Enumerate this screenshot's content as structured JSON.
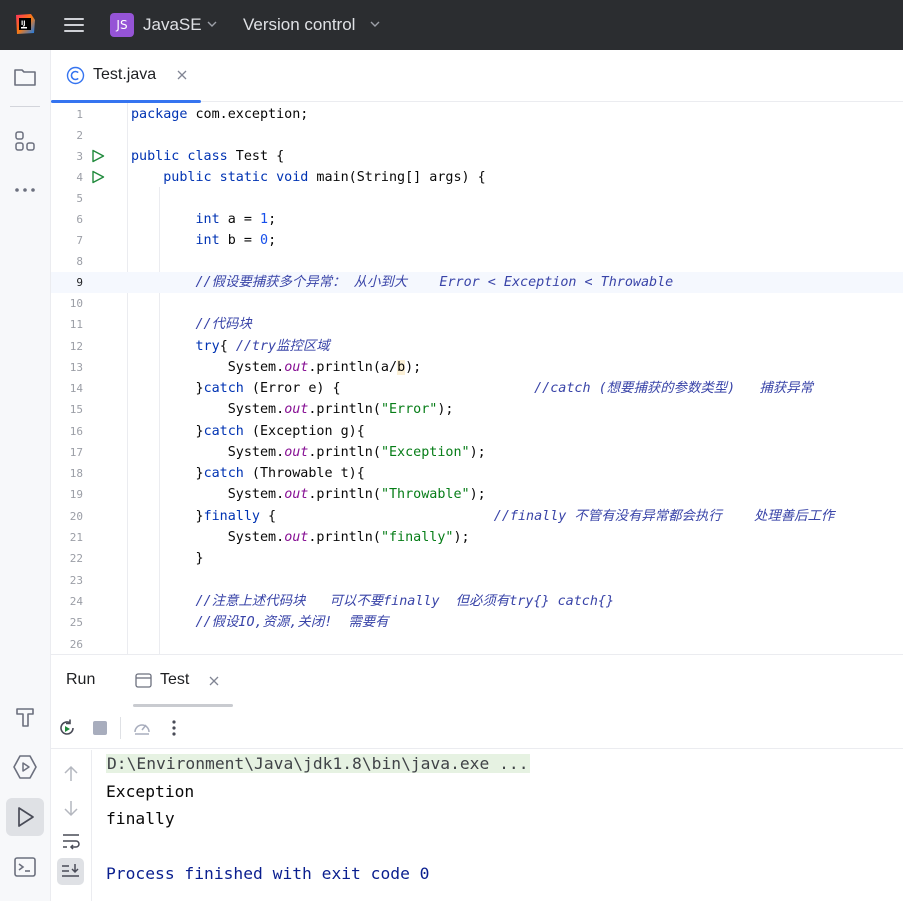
{
  "titlebar": {
    "project_badge": "JS",
    "project_name": "JavaSE",
    "vcs_label": "Version control"
  },
  "editor_tab": {
    "filename": "Test.java"
  },
  "code_lines": [
    {
      "n": "1"
    },
    {
      "n": "2"
    },
    {
      "n": "3"
    },
    {
      "n": "4"
    },
    {
      "n": "5"
    },
    {
      "n": "6"
    },
    {
      "n": "7"
    },
    {
      "n": "8"
    },
    {
      "n": "9"
    },
    {
      "n": "10"
    },
    {
      "n": "11"
    },
    {
      "n": "12"
    },
    {
      "n": "13"
    },
    {
      "n": "14"
    },
    {
      "n": "15"
    },
    {
      "n": "16"
    },
    {
      "n": "17"
    },
    {
      "n": "18"
    },
    {
      "n": "19"
    },
    {
      "n": "20"
    },
    {
      "n": "21"
    },
    {
      "n": "22"
    },
    {
      "n": "23"
    },
    {
      "n": "24"
    },
    {
      "n": "25"
    },
    {
      "n": "26"
    }
  ],
  "code": {
    "l1_kw": "package",
    "l1_rest": " com.exception;",
    "l3_kw": "public class",
    "l3_rest": " Test {",
    "l4_kw": "public static void",
    "l4_rest": " main(String[] args) {",
    "l6_kw": "int",
    "l6_rest": " a = ",
    "l6_num": "1",
    "l6_end": ";",
    "l7_kw": "int",
    "l7_rest": " b = ",
    "l7_num": "0",
    "l7_end": ";",
    "l9_cmt": "//假设要捕获多个异常： 从小到大    Error < Exception < Throwable",
    "l11_cmt": "//代码块",
    "l12_kw": "try",
    "l12_rest": "{ ",
    "l12_cmt": "//try监控区域",
    "l13_a": "System.",
    "l13_fld": "out",
    "l13_b": ".println(a/",
    "l13_mark": "b",
    "l13_c": ");",
    "l14_a": "}",
    "l14_kw": "catch",
    "l14_rest": " (Error e) {",
    "l14_cmt": "//catch (想要捕获的参数类型)   捕获异常",
    "l15_a": "System.",
    "l15_fld": "out",
    "l15_b": ".println(",
    "l15_str": "\"Error\"",
    "l15_c": ");",
    "l16_a": "}",
    "l16_kw": "catch",
    "l16_rest": " (Exception g){",
    "l17_a": "System.",
    "l17_fld": "out",
    "l17_b": ".println(",
    "l17_str": "\"Exception\"",
    "l17_c": ");",
    "l18_a": "}",
    "l18_kw": "catch",
    "l18_rest": " (Throwable t){",
    "l19_a": "System.",
    "l19_fld": "out",
    "l19_b": ".println(",
    "l19_str": "\"Throwable\"",
    "l19_c": ");",
    "l20_a": "}",
    "l20_kw": "finally",
    "l20_rest": " {",
    "l20_cmt": "//finally 不管有没有异常都会执行    处理善后工作",
    "l21_a": "System.",
    "l21_fld": "out",
    "l21_b": ".println(",
    "l21_str": "\"finally\"",
    "l21_c": ");",
    "l22": "}",
    "l24_cmt": "//注意上述代码块   可以不要finally  但必须有try{} catch{}",
    "l25_cmt": "//假设IO,资源,关闭!  需要有"
  },
  "run_panel": {
    "title": "Run",
    "tab_label": "Test"
  },
  "console": {
    "command": "D:\\Environment\\Java\\jdk1.8\\bin\\java.exe ...",
    "out1": "Exception",
    "out2": "finally",
    "exit": "Process finished with exit code 0"
  }
}
